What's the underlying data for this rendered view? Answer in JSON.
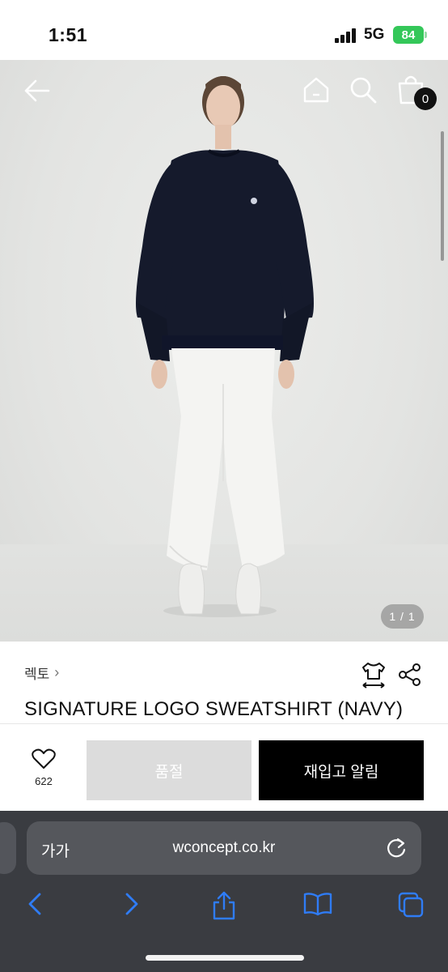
{
  "status_bar": {
    "time": "1:51",
    "network": "5G",
    "battery": "84"
  },
  "product_image": {
    "counter": "1 / 1",
    "cart_count": "0"
  },
  "product": {
    "brand": "렉토",
    "name": "SIGNATURE LOGO SWEATSHIRT (NAVY)"
  },
  "actions": {
    "like_count": "622",
    "soldout_label": "품절",
    "restock_label": "재입고 알림"
  },
  "browser": {
    "text_size_label": "가가",
    "url": "wconcept.co.kr"
  },
  "colors": {
    "accent": "#000000",
    "soldout": "#dcdcdc",
    "battery": "#34c759",
    "browser_bar": "#3a3c41",
    "ios_link": "#2f7cf6"
  }
}
